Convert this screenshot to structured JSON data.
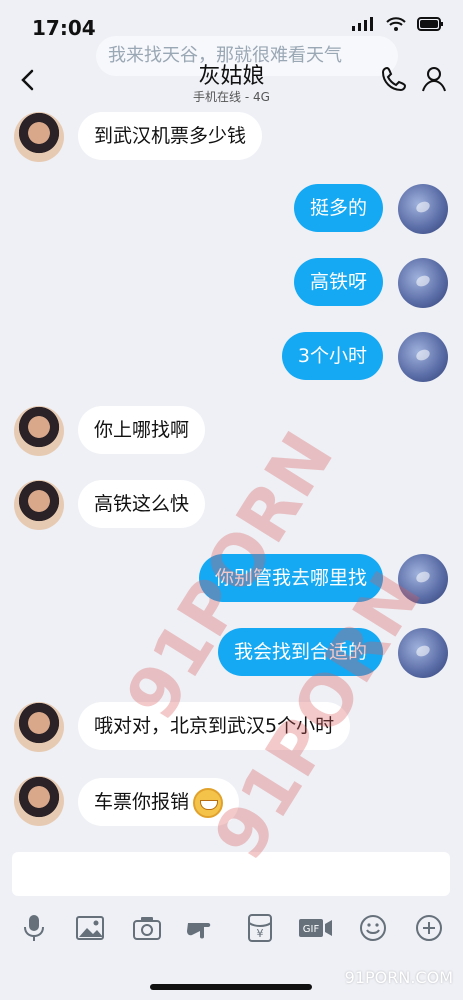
{
  "status_bar": {
    "time": "17:04"
  },
  "header": {
    "title": "灰姑娘",
    "subtitle": "手机在线 - 4G"
  },
  "ghost_text": "我来找天谷，那就很难看天气",
  "messages": [
    {
      "text": "到武汉机票多少钱"
    },
    {
      "text": "挺多的"
    },
    {
      "text": "高铁呀"
    },
    {
      "text": "3个小时"
    },
    {
      "text": "你上哪找啊"
    },
    {
      "text": "高铁这么快"
    },
    {
      "text": "你别管我去哪里找"
    },
    {
      "text": "我会找到合适的"
    },
    {
      "text": "哦对对，北京到武汉5个小时"
    },
    {
      "text": "车票你报销"
    }
  ],
  "toolbar": {
    "items": [
      "mic-icon",
      "image-icon",
      "camera-icon",
      "hand-icon",
      "red-envelope-icon",
      "gif-icon",
      "smile-icon",
      "plus-icon"
    ]
  },
  "watermark": {
    "big": "91PORN",
    "site": "91PORN.COM"
  }
}
